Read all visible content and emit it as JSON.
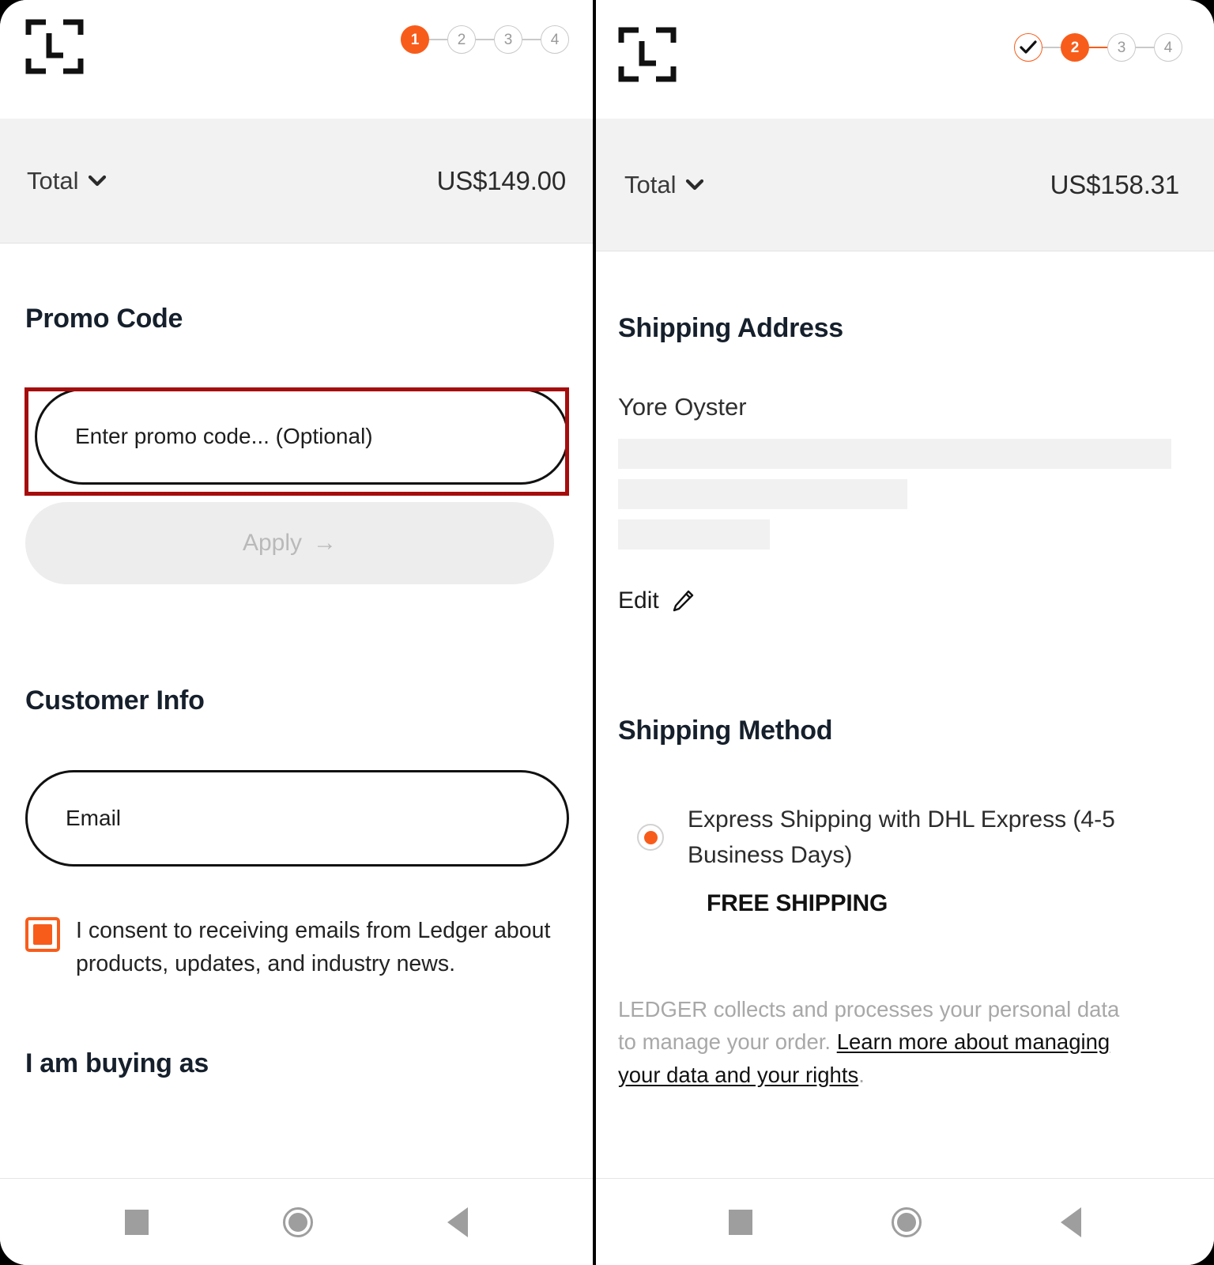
{
  "brand": {
    "accent": "#f85c1a",
    "annotation": "#a50d0d",
    "logo_name": "ledger-logo"
  },
  "left": {
    "stepper": {
      "steps": [
        "1",
        "2",
        "3",
        "4"
      ],
      "active_index": 0
    },
    "total": {
      "label": "Total",
      "amount": "US$149.00"
    },
    "promo": {
      "heading": "Promo Code",
      "input_placeholder": "Enter promo code... (Optional)",
      "input_value": "",
      "apply_label": "Apply",
      "apply_arrow": "→"
    },
    "customer": {
      "heading": "Customer Info",
      "email_label": "Email",
      "email_value": "",
      "consent_text": "I consent to receiving emails from Ledger about products, updates, and industry news.",
      "consent_checked": true
    },
    "buying_as_heading": "I am buying as"
  },
  "right": {
    "stepper": {
      "steps": [
        "✓",
        "2",
        "3",
        "4"
      ],
      "active_index": 1,
      "completed_index": 0
    },
    "total": {
      "label": "Total",
      "amount": "US$158.31"
    },
    "shipping_address": {
      "heading": "Shipping Address",
      "name": "Yore Oyster",
      "redacted_lines": 3,
      "edit_label": "Edit"
    },
    "shipping_method": {
      "heading": "Shipping Method",
      "option_label": "Express Shipping with DHL Express (4-5 Business Days)",
      "option_price": "FREE SHIPPING",
      "selected": true
    },
    "legal": {
      "text_before": "LEDGER collects and processes your personal data to manage your order. ",
      "link_text": "Learn more about managing your data and your rights",
      "text_after": "."
    }
  },
  "navbar": {
    "recents_label": "recents-square",
    "home_label": "home-circle",
    "back_label": "back-triangle"
  }
}
